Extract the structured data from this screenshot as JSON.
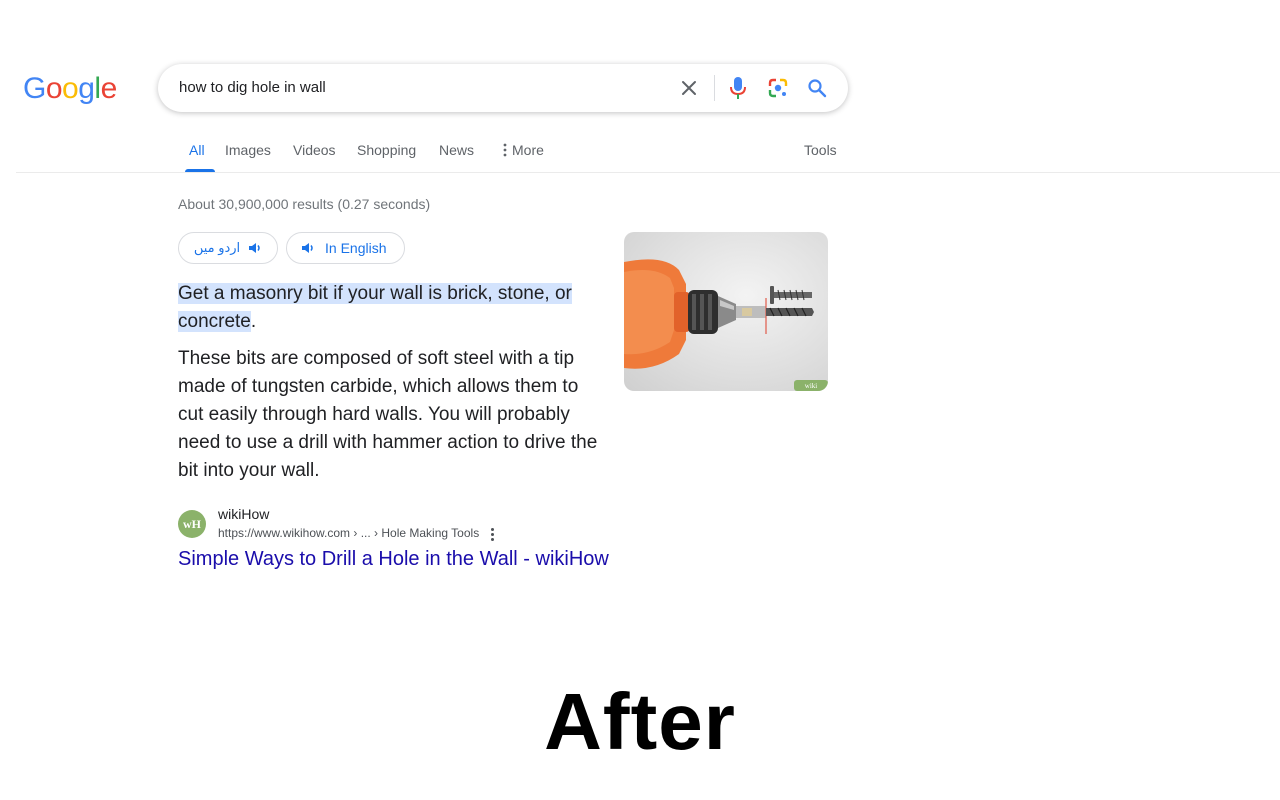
{
  "logo": {
    "letters": [
      "G",
      "o",
      "o",
      "g",
      "l",
      "e"
    ],
    "colors": [
      "#4285f4",
      "#ea4335",
      "#fbbc05",
      "#4285f4",
      "#34a853",
      "#ea4335"
    ]
  },
  "search": {
    "query": "how to dig hole in wall"
  },
  "tabs": [
    {
      "label": "All",
      "active": true
    },
    {
      "label": "Images"
    },
    {
      "label": "Videos"
    },
    {
      "label": "Shopping"
    },
    {
      "label": "News"
    },
    {
      "label": "More"
    }
  ],
  "tools_label": "Tools",
  "stats": "About 30,900,000 results (0.27 seconds)",
  "audio_chips": {
    "urdu": "اردو میں",
    "english": "In English"
  },
  "snippet": {
    "highlight": "Get a masonry bit if your wall is brick, stone, or concrete",
    "highlight_end": ".",
    "body": "These bits are composed of soft steel with a tip made of tungsten carbide, which allows them to cut easily through hard walls. You will probably need to use a drill with hammer action to drive the bit into your wall."
  },
  "thumbnail": {
    "watermark": "wiki"
  },
  "source": {
    "favicon_text": "wH",
    "site_name": "wikiHow",
    "url": "https://www.wikihow.com › ... › Hole Making Tools",
    "title": "Simple Ways to Drill a Hole in the Wall - wikiHow"
  },
  "caption": "After",
  "colors": {
    "accent": "#1a73e8",
    "link": "#1a0dab",
    "highlight": "#d3e3fd"
  },
  "icons": [
    "close-icon",
    "mic-icon",
    "lens-icon",
    "search-icon",
    "speaker-icon",
    "more-dots-icon",
    "kebab-icon"
  ]
}
